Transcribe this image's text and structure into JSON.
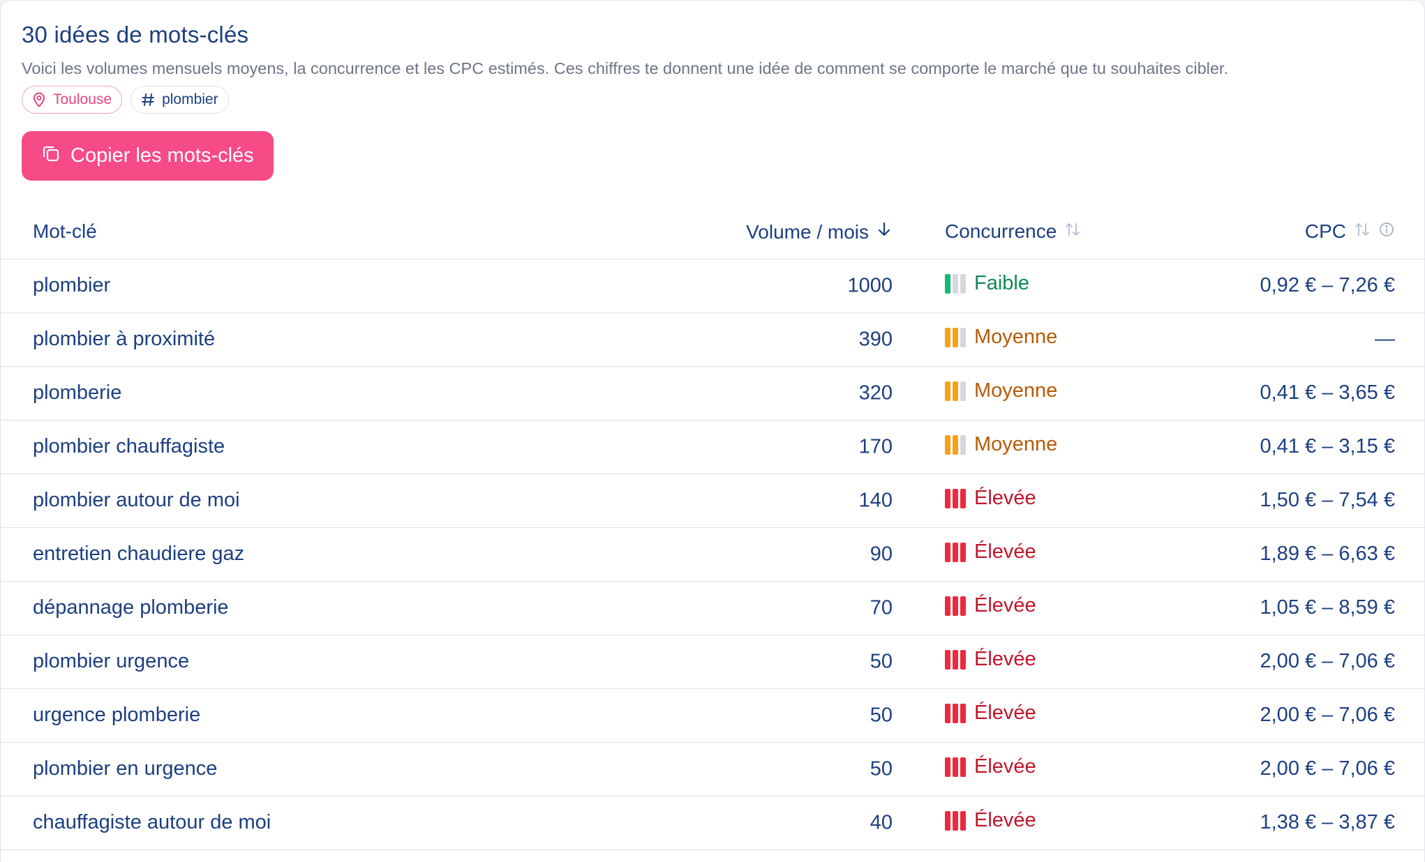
{
  "header": {
    "title": "30 idées de mots-clés",
    "subtitle": "Voici les volumes mensuels moyens, la concurrence et les CPC estimés. Ces chiffres te donnent une idée de comment se comporte le marché que tu souhaites cibler."
  },
  "chips": {
    "location": "Toulouse",
    "keyword": "plombier"
  },
  "copy_button": {
    "label": "Copier les mots-clés"
  },
  "colors": {
    "accent": "#f64b86",
    "low": "#17b978",
    "medium": "#f7a11a",
    "high": "#ec2a3f"
  },
  "table": {
    "headers": {
      "keyword": "Mot-clé",
      "volume": "Volume / mois",
      "competition": "Concurrence",
      "cpc": "CPC"
    },
    "rows": [
      {
        "keyword": "plombier",
        "volume": "1000",
        "competition": "Faible",
        "level": 1,
        "cpc": "0,92 € – 7,26 €"
      },
      {
        "keyword": "plombier à proximité",
        "volume": "390",
        "competition": "Moyenne",
        "level": 2,
        "cpc": "—"
      },
      {
        "keyword": "plomberie",
        "volume": "320",
        "competition": "Moyenne",
        "level": 2,
        "cpc": "0,41 € – 3,65 €"
      },
      {
        "keyword": "plombier chauffagiste",
        "volume": "170",
        "competition": "Moyenne",
        "level": 2,
        "cpc": "0,41 € – 3,15 €"
      },
      {
        "keyword": "plombier autour de moi",
        "volume": "140",
        "competition": "Élevée",
        "level": 3,
        "cpc": "1,50 € – 7,54 €"
      },
      {
        "keyword": "entretien chaudiere gaz",
        "volume": "90",
        "competition": "Élevée",
        "level": 3,
        "cpc": "1,89 € – 6,63 €"
      },
      {
        "keyword": "dépannage plomberie",
        "volume": "70",
        "competition": "Élevée",
        "level": 3,
        "cpc": "1,05 € – 8,59 €"
      },
      {
        "keyword": "plombier urgence",
        "volume": "50",
        "competition": "Élevée",
        "level": 3,
        "cpc": "2,00 € – 7,06 €"
      },
      {
        "keyword": "urgence plomberie",
        "volume": "50",
        "competition": "Élevée",
        "level": 3,
        "cpc": "2,00 € – 7,06 €"
      },
      {
        "keyword": "plombier en urgence",
        "volume": "50",
        "competition": "Élevée",
        "level": 3,
        "cpc": "2,00 € – 7,06 €"
      },
      {
        "keyword": "chauffagiste autour de moi",
        "volume": "40",
        "competition": "Élevée",
        "level": 3,
        "cpc": "1,38 € – 3,87 €"
      }
    ]
  }
}
